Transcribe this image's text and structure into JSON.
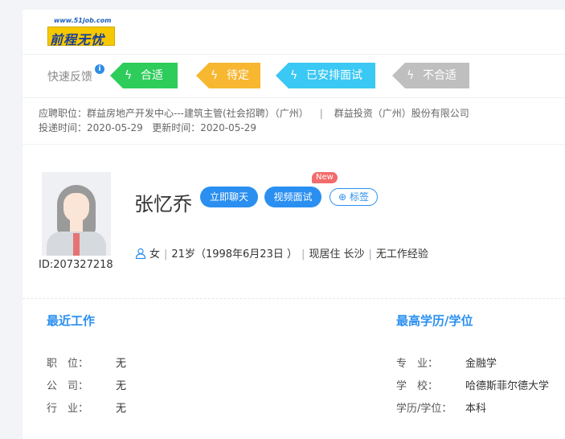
{
  "logo": {
    "url_text": "www.51job.com",
    "brand_text": "前程无忧"
  },
  "feedback": {
    "label": "快速反馈",
    "info_icon": "i",
    "tags": [
      {
        "label": "合适",
        "color": "#2ecc5b"
      },
      {
        "label": "待定",
        "color": "#f7b731"
      },
      {
        "label": "已安排面试",
        "color": "#3ac8f4"
      },
      {
        "label": "不合适",
        "color": "#bfbfbf"
      }
    ]
  },
  "job": {
    "position_label": "应聘职位：",
    "position": "群益房地产开发中心---建筑主管(社会招聘）（广州）",
    "company": "群益投资（广州）股份有限公司",
    "submit_label": "投递时间：",
    "submit_date": "2020-05-29",
    "update_label": "更新时间：",
    "update_date": "2020-05-29"
  },
  "profile": {
    "name": "张忆乔",
    "id": "ID:207327218",
    "chat_button": "立即聊天",
    "video_button": "视频面试",
    "new_badge": "New",
    "tag_button": "标签",
    "gender": "女",
    "age": "21岁（1998年6月23日 ）",
    "residence": "现居住 长沙",
    "experience": "无工作经验"
  },
  "recent_work": {
    "title": "最近工作",
    "rows": [
      {
        "label": "职　位：",
        "value": "无"
      },
      {
        "label": "公　司：",
        "value": "无"
      },
      {
        "label": "行　业：",
        "value": "无"
      }
    ]
  },
  "education": {
    "title": "最高学历/学位",
    "rows": [
      {
        "label": "专　业：",
        "value": "金融学"
      },
      {
        "label": "学　校：",
        "value": "哈德斯菲尔德大学"
      },
      {
        "label": "学历/学位：",
        "value": "本科"
      }
    ]
  }
}
